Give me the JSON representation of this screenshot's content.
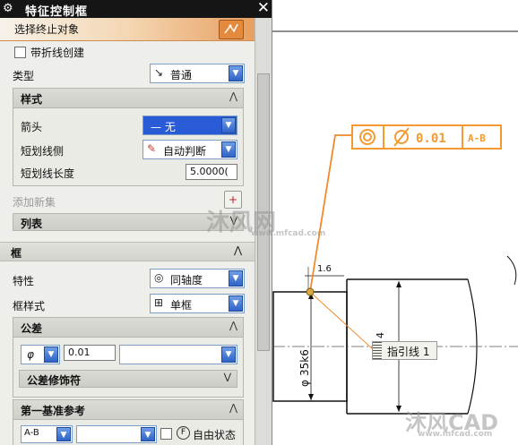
{
  "dialog": {
    "title": "特征控制框",
    "select_end_object": "选择终止对象",
    "create_with_jog": "带折线创建",
    "type_label": "类型",
    "type_value": "普通",
    "style": {
      "header": "样式",
      "arrow_label": "箭头",
      "arrow_value": "无",
      "stub_side_label": "短划线侧",
      "stub_side_value": "自动判断",
      "stub_length_label": "短划线长度",
      "stub_length_value": "5.0000("
    },
    "add_new_set": "添加新集",
    "list_header": "列表",
    "frame": {
      "header": "框",
      "characteristic_label": "特性",
      "characteristic_value": "同轴度",
      "frame_style_label": "框样式",
      "frame_style_value": "单框",
      "tolerance": {
        "header": "公差",
        "symbol": "φ",
        "value": "0.01",
        "modifier_header": "公差修饰符"
      },
      "datum": {
        "header": "第一基准参考",
        "value": "A-B",
        "free_state_label": "自由状态",
        "free_state_symbol": "F"
      }
    }
  },
  "drawing": {
    "fcf_tolerance": "0.01",
    "fcf_datum": "A-B",
    "leader_label": "指引线 1",
    "stub_dim": "1.6",
    "vertical_dim": "35k6",
    "vertical_dim_prefix": "φ",
    "height_dim": "4",
    "watermark_1": "沐风网",
    "watermark_1_url": "www.mfcad.com",
    "watermark_2": "沐风CAD",
    "watermark_2_url": "www.mfcad.com"
  },
  "colors": {
    "accent_orange": "#f39a30",
    "leader_orange": "#f08a2a",
    "title_bar": "#151515",
    "selected_blue": "#2a5bd7"
  }
}
